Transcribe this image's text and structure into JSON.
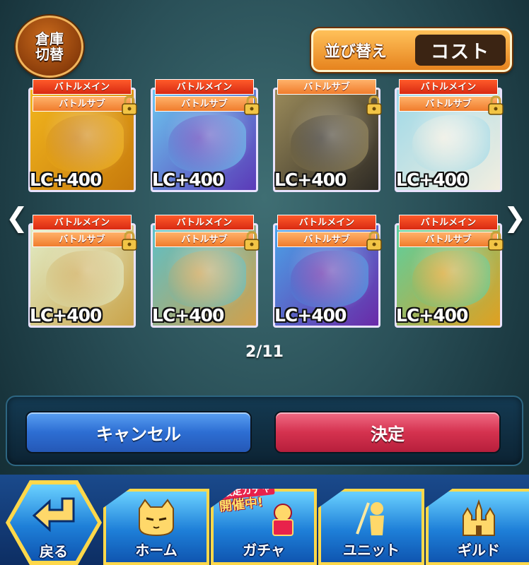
{
  "header": {
    "warehouse_toggle_line1": "倉庫",
    "warehouse_toggle_line2": "切替",
    "sort_label": "並び替え",
    "sort_value": "コスト"
  },
  "cards": [
    {
      "tag1": "バトルメイン",
      "tag2": "バトルサブ",
      "locked": true,
      "lc": "LC+400",
      "art": [
        "#f2b61e",
        "#c77a0c"
      ]
    },
    {
      "tag1": "バトルメイン",
      "tag2": "バトルサブ",
      "locked": true,
      "lc": "LC+400",
      "art": [
        "#6bc6ef",
        "#5b3ab8"
      ]
    },
    {
      "tag1": "バトルサブ",
      "tag2": "",
      "locked": true,
      "lc": "LC+400",
      "art": [
        "#9a8a5a",
        "#2e2a24"
      ]
    },
    {
      "tag1": "バトルメイン",
      "tag2": "バトルサブ",
      "locked": true,
      "lc": "LC+400",
      "art": [
        "#9fd9e8",
        "#f2eee0"
      ]
    },
    {
      "tag1": "バトルメイン",
      "tag2": "バトルサブ",
      "locked": true,
      "lc": "LC+400",
      "art": [
        "#e2edc8",
        "#caa44a"
      ]
    },
    {
      "tag1": "バトルメイン",
      "tag2": "バトルサブ",
      "locked": true,
      "lc": "LC+400",
      "art": [
        "#5bc0c8",
        "#d2a04a"
      ]
    },
    {
      "tag1": "バトルメイン",
      "tag2": "バトルサブ",
      "locked": true,
      "lc": "LC+400",
      "art": [
        "#4aa3e8",
        "#6a2aa8"
      ]
    },
    {
      "tag1": "バトルメイン",
      "tag2": "バトルサブ",
      "locked": true,
      "lc": "LC+400",
      "art": [
        "#5ad0a0",
        "#e0a020"
      ]
    }
  ],
  "pagination": "2/11",
  "actions": {
    "cancel": "キャンセル",
    "confirm": "決定"
  },
  "nav": {
    "back": "戻る",
    "home": "ホーム",
    "gacha": "ガチャ",
    "gacha_banner_line1": "限定ガチャ",
    "gacha_banner_line2": "開催中!",
    "unit": "ユニット",
    "guild": "ギルド"
  },
  "colors": {
    "cancel": "#2d6ed3",
    "confirm": "#d5324f",
    "nav_border": "#ffd84a"
  }
}
